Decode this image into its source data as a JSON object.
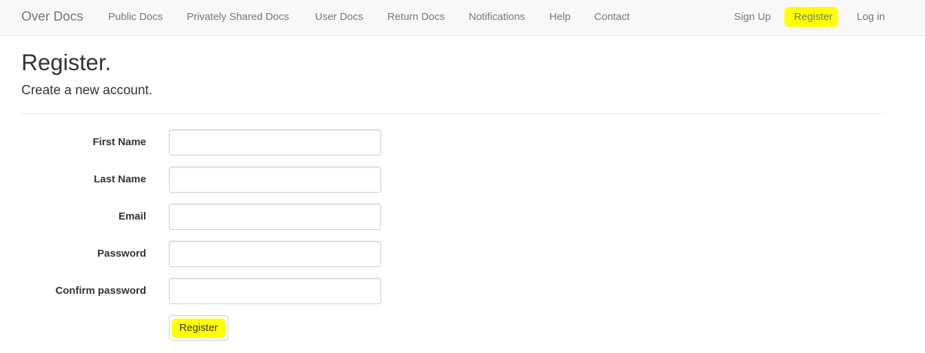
{
  "navbar": {
    "brand": "Over Docs",
    "links": [
      "Public Docs",
      "Privately Shared Docs",
      "User Docs",
      "Return Docs",
      "Notifications",
      "Help",
      "Contact"
    ],
    "right_links": [
      "Sign Up",
      "Register",
      "Log in"
    ],
    "highlighted_link": "Register",
    "highlight_color": "#ffff00"
  },
  "page": {
    "title": "Register.",
    "subtitle": "Create a new account."
  },
  "form": {
    "fields": [
      {
        "label": "First Name",
        "value": ""
      },
      {
        "label": "Last Name",
        "value": ""
      },
      {
        "label": "Email",
        "value": ""
      },
      {
        "label": "Password",
        "value": ""
      },
      {
        "label": "Confirm password",
        "value": ""
      }
    ],
    "submit_label": "Register"
  }
}
